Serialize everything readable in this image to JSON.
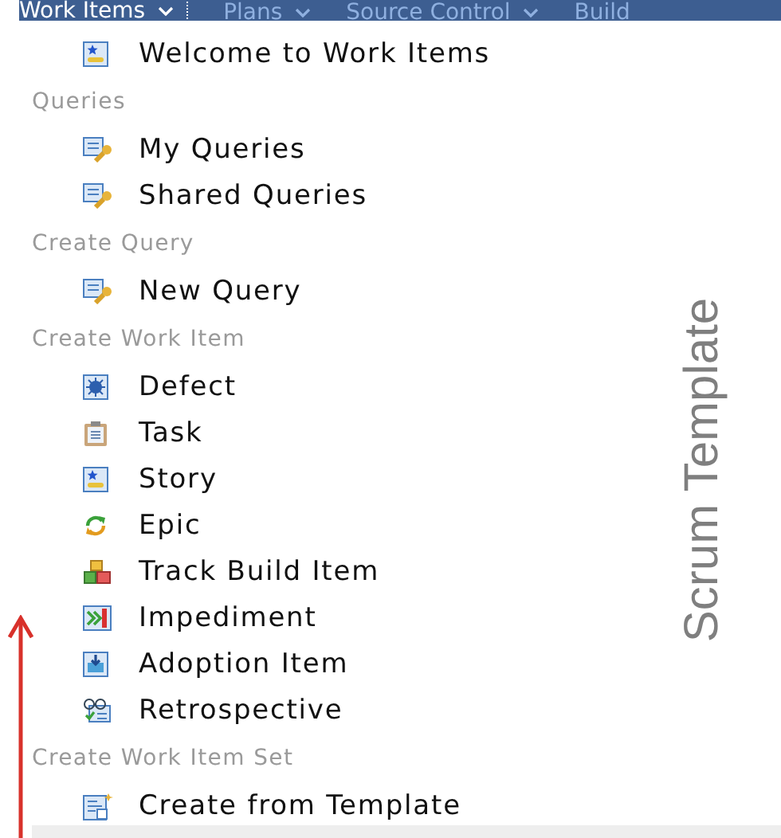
{
  "nav": {
    "tabs": [
      {
        "label": "Work Items",
        "selected": true,
        "has_menu": true
      },
      {
        "label": "Plans",
        "selected": false,
        "has_menu": true
      },
      {
        "label": "Source Control",
        "selected": false,
        "has_menu": true
      },
      {
        "label": "Build",
        "selected": false,
        "has_menu": false
      }
    ]
  },
  "sections": [
    {
      "items": [
        {
          "label": "Welcome to Work Items",
          "kind": "story"
        }
      ]
    },
    {
      "heading": "Queries",
      "items": [
        {
          "label": "My Queries",
          "kind": "query"
        },
        {
          "label": "Shared Queries",
          "kind": "query"
        }
      ]
    },
    {
      "heading": "Create Query",
      "items": [
        {
          "label": "New Query",
          "kind": "query"
        }
      ]
    },
    {
      "heading": "Create Work Item",
      "items": [
        {
          "label": "Defect",
          "kind": "defect"
        },
        {
          "label": "Task",
          "kind": "task"
        },
        {
          "label": "Story",
          "kind": "story"
        },
        {
          "label": "Epic",
          "kind": "epic"
        },
        {
          "label": "Track Build Item",
          "kind": "build"
        },
        {
          "label": "Impediment",
          "kind": "impediment"
        },
        {
          "label": "Adoption Item",
          "kind": "adoption"
        },
        {
          "label": "Retrospective",
          "kind": "retrospective"
        }
      ]
    },
    {
      "heading": "Create Work Item Set",
      "items": [
        {
          "label": "Create from Template",
          "kind": "template"
        }
      ]
    }
  ],
  "annotation": {
    "label": "Scrum Template"
  }
}
